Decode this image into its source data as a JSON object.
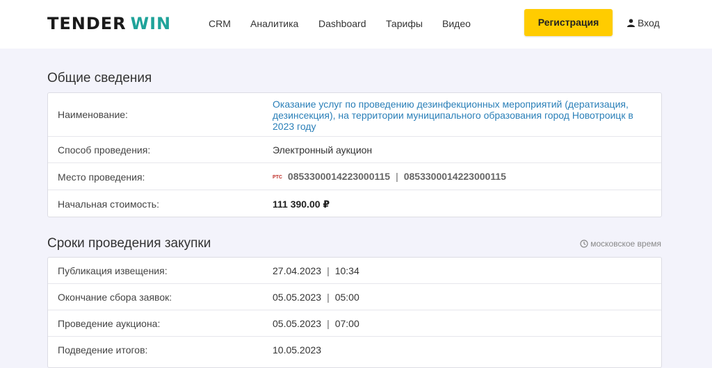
{
  "header": {
    "logo_part1": "TENDER",
    "logo_part2": "WIN",
    "nav": [
      "CRM",
      "Аналитика",
      "Dashboard",
      "Тарифы",
      "Видео"
    ],
    "register_label": "Регистрация",
    "login_label": "Вход"
  },
  "general": {
    "title": "Общие сведения",
    "name_key": "Наименование:",
    "name_value": "Оказание услуг по проведению дезинфекционных мероприятий (дератизация, дезинсекция), на территории муниципального образования город Новотроицк в 2023 году",
    "method_key": "Способ проведения:",
    "method_value": "Электронный аукцион",
    "place_key": "Место проведения:",
    "place_badge": "РТС",
    "place_num1": "0853300014223000115",
    "place_sep": "|",
    "place_num2": "0853300014223000115",
    "price_key": "Начальная стоимость:",
    "price_value": "111 390.00 ₽"
  },
  "terms": {
    "title": "Сроки проведения закупки",
    "tz_label": "московское время",
    "rows": [
      {
        "key": "Публикация извещения:",
        "date": "27.04.2023",
        "sep": "|",
        "time": "10:34"
      },
      {
        "key": "Окончание сбора заявок:",
        "date": "05.05.2023",
        "sep": "|",
        "time": "05:00"
      },
      {
        "key": "Проведение аукциона:",
        "date": "05.05.2023",
        "sep": "|",
        "time": "07:00"
      },
      {
        "key": "Подведение итогов:",
        "date": "10.05.2023"
      }
    ]
  },
  "colors": {
    "accent_yellow": "#ffcc00",
    "logo_teal": "#1fa39a",
    "link_blue": "#2a7fb8",
    "background": "#f3f3fb"
  }
}
